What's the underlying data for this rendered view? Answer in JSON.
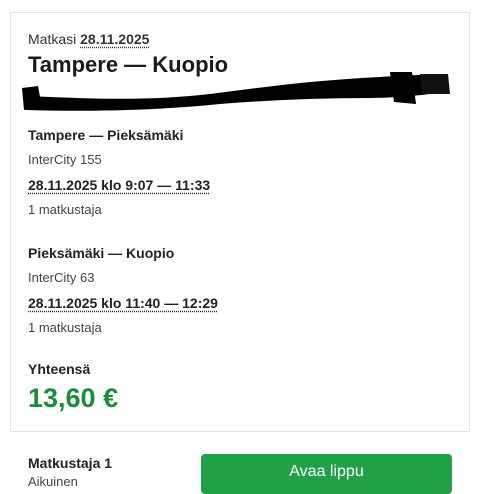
{
  "trip": {
    "date_label": "Matkasi",
    "date": "28.11.2025",
    "title": "Tampere — Kuopio"
  },
  "legs": [
    {
      "route": "Tampere — Pieksämäki",
      "train": "InterCity 155",
      "time": "28.11.2025 klo 9:07 — 11:33",
      "passengers": "1 matkustaja"
    },
    {
      "route": "Pieksämäki — Kuopio",
      "train": "InterCity 63",
      "time": "28.11.2025 klo 11:40 — 12:29",
      "passengers": "1 matkustaja"
    }
  ],
  "total": {
    "label": "Yhteensä",
    "price": "13,60 €"
  },
  "passenger": {
    "name": "Matkustaja 1",
    "type": "Aikuinen"
  },
  "actions": {
    "open_ticket_label": "Avaa lippu"
  },
  "colors": {
    "accent_green": "#20a148",
    "price_green": "#1d8b3c",
    "redaction": "#000000"
  }
}
